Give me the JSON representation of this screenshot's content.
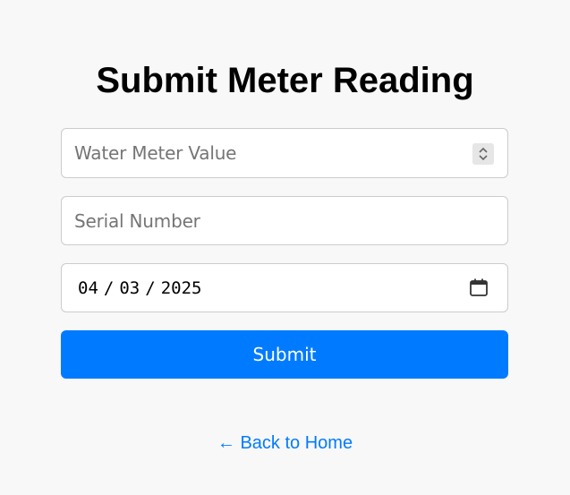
{
  "page": {
    "title": "Submit Meter Reading"
  },
  "form": {
    "water_meter": {
      "placeholder": "Water Meter Value",
      "value": ""
    },
    "serial_number": {
      "placeholder": "Serial Number",
      "value": ""
    },
    "date": {
      "month": "04",
      "day": "03",
      "year": "2025",
      "separator": "/"
    },
    "submit_label": "Submit"
  },
  "nav": {
    "back_label": "← Back to Home"
  },
  "colors": {
    "accent": "#007bff",
    "background": "#f8f8f8",
    "field_border": "#cccccc"
  },
  "icons": {
    "spinner": "stepper-arrows-icon",
    "calendar": "calendar-icon"
  }
}
